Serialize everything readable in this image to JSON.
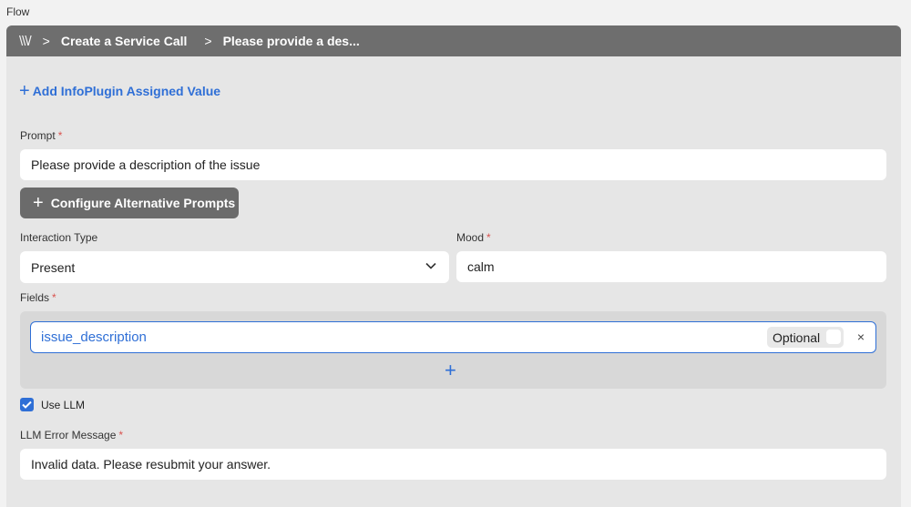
{
  "header": {
    "flow_label": "Flow"
  },
  "breadcrumb": {
    "home": "\\\\\\/",
    "separator": ">",
    "items": [
      "Create a Service Call",
      "Please provide a des..."
    ]
  },
  "actions": {
    "add_infoplugin": "Add InfoPlugin Assigned Value",
    "configure_alt_prompts": "Configure Alternative Prompts"
  },
  "form": {
    "prompt": {
      "label": "Prompt",
      "required": "*",
      "value": "Please provide a description of the issue"
    },
    "interaction_type": {
      "label": "Interaction Type",
      "selected": "Present"
    },
    "mood": {
      "label": "Mood",
      "required": "*",
      "value": "calm"
    },
    "fields": {
      "label": "Fields",
      "required": "*",
      "items": [
        {
          "name": "issue_description",
          "optional_label": "Optional",
          "optional": false
        }
      ],
      "remove_symbol": "×"
    },
    "use_llm": {
      "label": "Use LLM",
      "checked": true
    },
    "llm_error": {
      "label": "LLM Error Message",
      "required": "*",
      "value": "Invalid data. Please resubmit your answer."
    }
  },
  "colors": {
    "accent": "#2f6fd6",
    "header_bar": "#6e6e6e",
    "panel_bg": "#e6e6e6",
    "required": "#d9534f"
  },
  "icons": [
    "plus-icon",
    "chevron-down-icon",
    "close-icon",
    "checkmark-icon"
  ]
}
